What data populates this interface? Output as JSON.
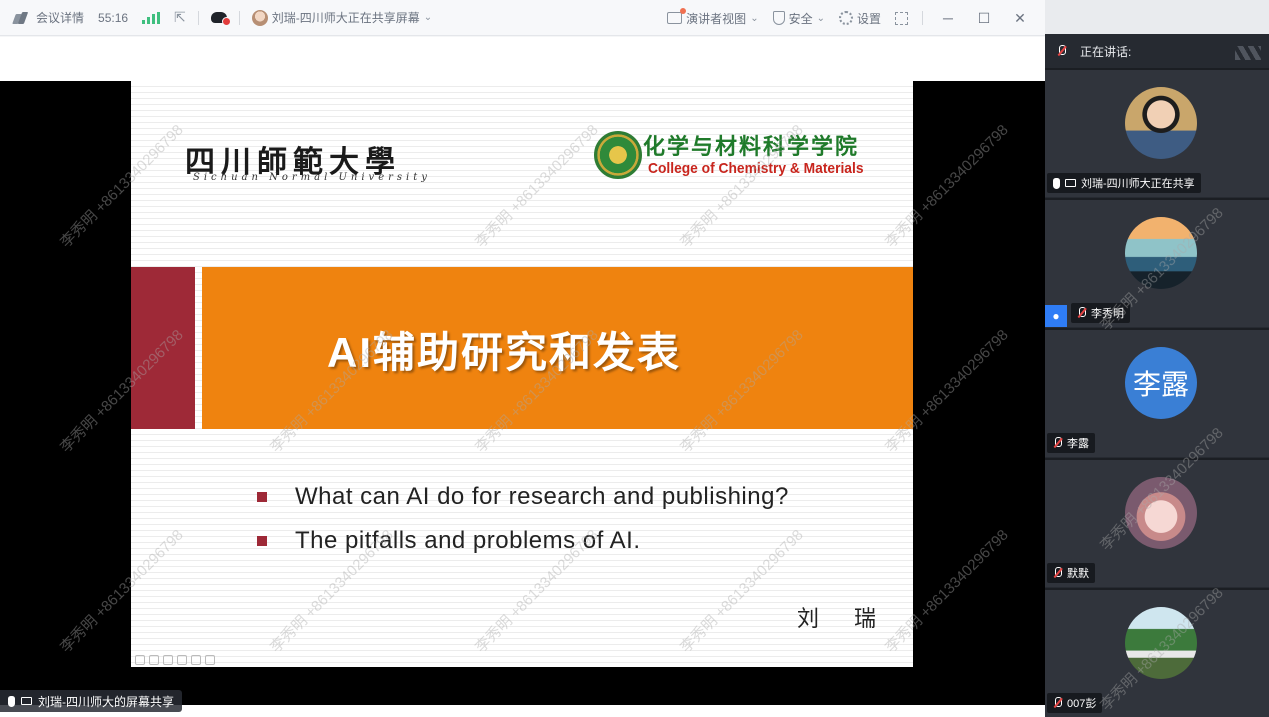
{
  "toolbar": {
    "meeting_details": "会议详情",
    "timer": "55:16",
    "sharer_status": "刘瑞-四川师大正在共享屏幕",
    "presenter_view": "演讲者视图",
    "security": "安全",
    "settings": "设置",
    "minimize": "─",
    "maximize": "☐",
    "close": "✕",
    "chevron": "⌄"
  },
  "slide": {
    "uni_name": "四川師範大學",
    "uni_name_en": "Sichuan Normal University",
    "college_cn": "化学与材料科学学院",
    "college_en": "College of Chemistry & Materials",
    "title": "AI辅助研究和发表",
    "bullets": [
      "What can AI do for research and publishing?",
      "The pitfalls and problems of AI."
    ],
    "author": "刘 瑞"
  },
  "watermark": "李秀明 +8613340296798",
  "share_label": "刘瑞-四川师大的屏幕共享",
  "panel": {
    "speaking_label": "正在讲话:",
    "participants": [
      {
        "name": "刘瑞-四川师大正在共享",
        "avatar": "photo-man"
      },
      {
        "name": "李秀明",
        "avatar": "photo-sunset"
      },
      {
        "name": "李露",
        "avatar_text": "李露"
      },
      {
        "name": "默默",
        "avatar": "photo-girl"
      },
      {
        "name": "007彭",
        "avatar": "photo-nature"
      }
    ]
  },
  "colors": {
    "band_orange": "#ef830f",
    "band_red": "#9e2937",
    "college_green": "#1f7a2a",
    "college_red": "#c8251d",
    "avatar_blue": "#3a7fd5"
  }
}
